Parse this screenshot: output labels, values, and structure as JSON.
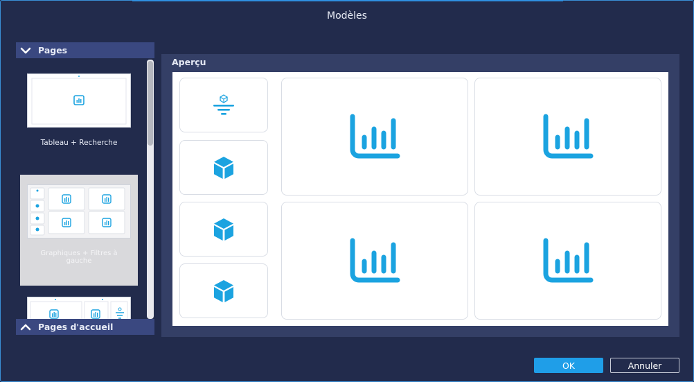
{
  "dialog": {
    "title": "Modèles"
  },
  "sidebar": {
    "pages_header": "Pages",
    "home_header": "Pages d'accueil",
    "templates": [
      {
        "label": "Tableau + Recherche",
        "selected": false
      },
      {
        "label": "Graphiques + Filtres à gauche",
        "selected": true
      },
      {
        "label": "",
        "selected": false
      }
    ]
  },
  "preview": {
    "label": "Aperçu"
  },
  "buttons": {
    "ok": "OK",
    "cancel": "Annuler"
  },
  "colors": {
    "accent": "#1f9ee8",
    "icon": "#1ba3e0",
    "header_bg": "#3a4880",
    "window_bg": "#222b4c"
  }
}
